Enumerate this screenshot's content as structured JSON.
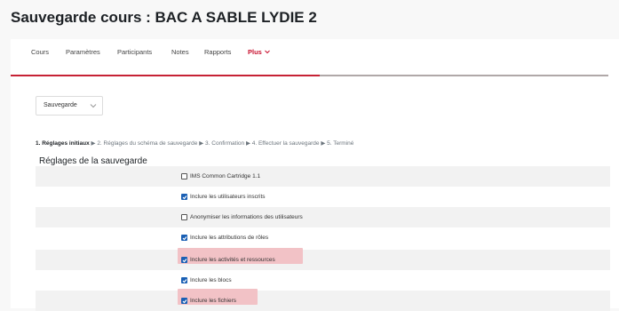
{
  "page": {
    "title": "Sauvegarde cours : BAC A SABLE LYDIE 2"
  },
  "nav": {
    "tabs": [
      {
        "label": "Cours"
      },
      {
        "label": "Paramètres"
      },
      {
        "label": "Participants"
      },
      {
        "label": "Notes"
      },
      {
        "label": "Rapports"
      },
      {
        "label": "Plus",
        "active": true
      }
    ],
    "accent_color": "#c62235"
  },
  "select": {
    "value": "Sauvegarde"
  },
  "steps": {
    "current": "1. Réglages initiaux",
    "rest": [
      "2. Réglages du schéma de sauvegarde",
      "3. Confirmation",
      "4. Effectuer la sauvegarde",
      "5. Terminé"
    ],
    "separator": "▶"
  },
  "section": {
    "heading": "Réglages de la sauvegarde"
  },
  "options": [
    {
      "label": "IMS Common Cartridge 1.1",
      "checked": false,
      "highlighted": false
    },
    {
      "label": "Inclure les utilisateurs inscrits",
      "checked": true,
      "highlighted": false
    },
    {
      "label": "Anonymiser les informations des utilisateurs",
      "checked": false,
      "highlighted": false
    },
    {
      "label": "Inclure les attributions de rôles",
      "checked": true,
      "highlighted": false
    },
    {
      "label": "Inclure les activités et ressources",
      "checked": true,
      "highlighted": true
    },
    {
      "label": "Inclure les blocs",
      "checked": true,
      "highlighted": false
    },
    {
      "label": "Inclure les fichiers",
      "checked": true,
      "highlighted": true
    }
  ],
  "colors": {
    "checkbox_checked": "#1a5fb4",
    "highlight": "#f2c2c6"
  }
}
